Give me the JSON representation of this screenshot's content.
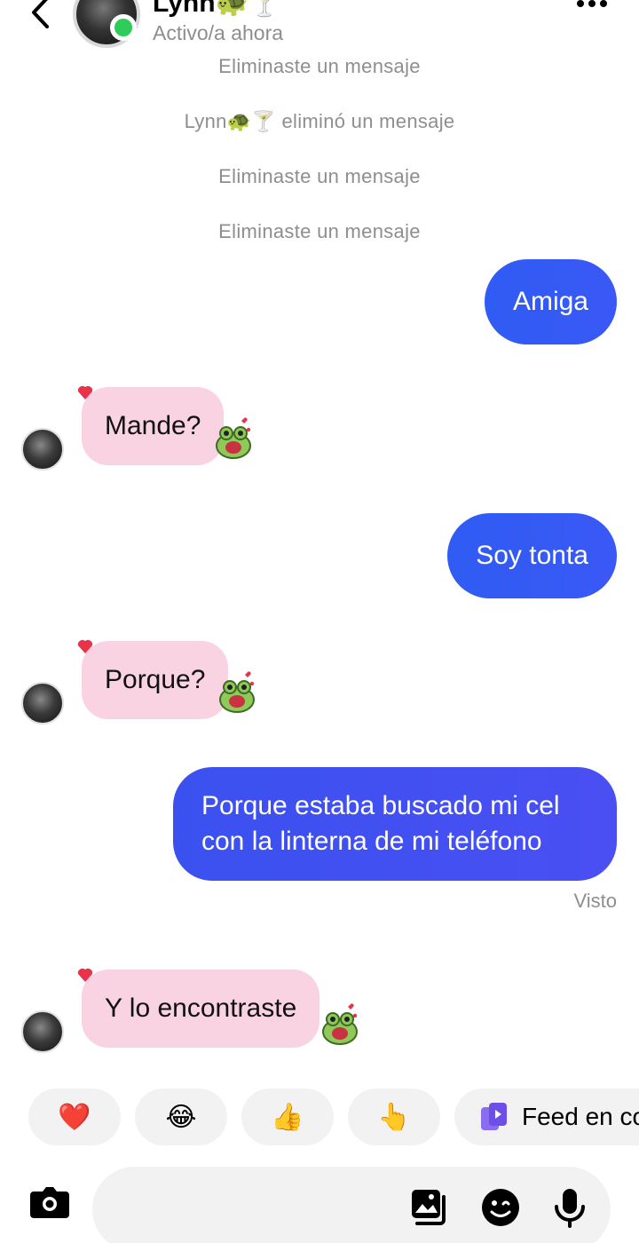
{
  "header": {
    "contact_name": "Lynn🐢🍸",
    "status": "Activo/a ahora"
  },
  "messages": {
    "system": [
      "Eliminaste un mensaje",
      "Lynn🐢🍸 eliminó un mensaje",
      "Eliminaste un mensaje",
      "Eliminaste un mensaje"
    ],
    "out_1": "Amiga",
    "in_1": "Mande?",
    "out_2": "Soy tonta",
    "in_2": "Porque?",
    "out_3_line1": "Porque estaba buscado mi cel",
    "out_3_line2": "con la linterna de mi teléfono",
    "seen": "Visto",
    "in_3": "Y lo encontraste"
  },
  "suggestions": {
    "heart": "❤️",
    "laugh": "😂",
    "thumbs": "👍",
    "point": "👆",
    "feed_label": "Feed en co"
  },
  "colors": {
    "outgoing_bubble": "#3458f4",
    "incoming_bubble": "#f9d3e1",
    "online": "#2ecc58",
    "reaction_heart": "#e8334a"
  },
  "icons": [
    "back-arrow-icon",
    "more-options-icon",
    "camera-icon",
    "gallery-icon",
    "sticker-icon",
    "microphone-icon",
    "heart-reaction-icon",
    "frog-sticker-icon"
  ]
}
